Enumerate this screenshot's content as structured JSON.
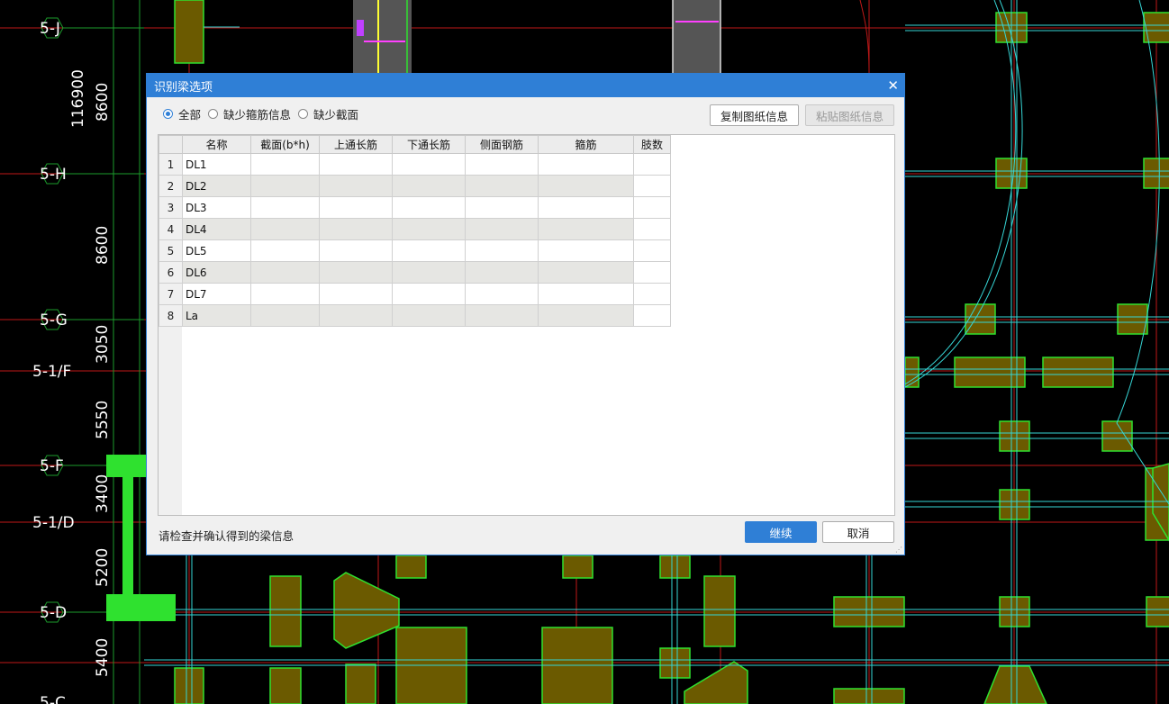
{
  "cad": {
    "axis_labels": [
      "5-J",
      "5-H",
      "5-G",
      "5-1/F",
      "5-F",
      "5-1/D",
      "5-D",
      "5-C"
    ],
    "dimension_labels": [
      "116900",
      "8600",
      "8600",
      "3050",
      "5550",
      "3400",
      "5200",
      "5400"
    ],
    "colors": {
      "grid_red": "#c01818",
      "beam_cyan": "#36d6d6",
      "column_green": "#2fe12f",
      "column_fill": "#6b5a00",
      "grid_green": "#1c9c2c"
    }
  },
  "dialog": {
    "title": "识别梁选项",
    "close_icon": "close-icon",
    "filters": [
      {
        "label": "全部",
        "checked": true
      },
      {
        "label": "缺少箍筋信息",
        "checked": false
      },
      {
        "label": "缺少截面",
        "checked": false
      }
    ],
    "copy_button": "复制图纸信息",
    "paste_button": "粘贴图纸信息",
    "columns": [
      "名称",
      "截面(b*h)",
      "上通长筋",
      "下通长筋",
      "侧面钢筋",
      "箍筋",
      "肢数"
    ],
    "rows": [
      {
        "num": "1",
        "name": "DL1"
      },
      {
        "num": "2",
        "name": "DL2"
      },
      {
        "num": "3",
        "name": "DL3"
      },
      {
        "num": "4",
        "name": "DL4"
      },
      {
        "num": "5",
        "name": "DL5"
      },
      {
        "num": "6",
        "name": "DL6"
      },
      {
        "num": "7",
        "name": "DL7"
      },
      {
        "num": "8",
        "name": "La"
      }
    ],
    "status_text": "请检查并确认得到的梁信息",
    "continue_button": "继续",
    "cancel_button": "取消"
  }
}
